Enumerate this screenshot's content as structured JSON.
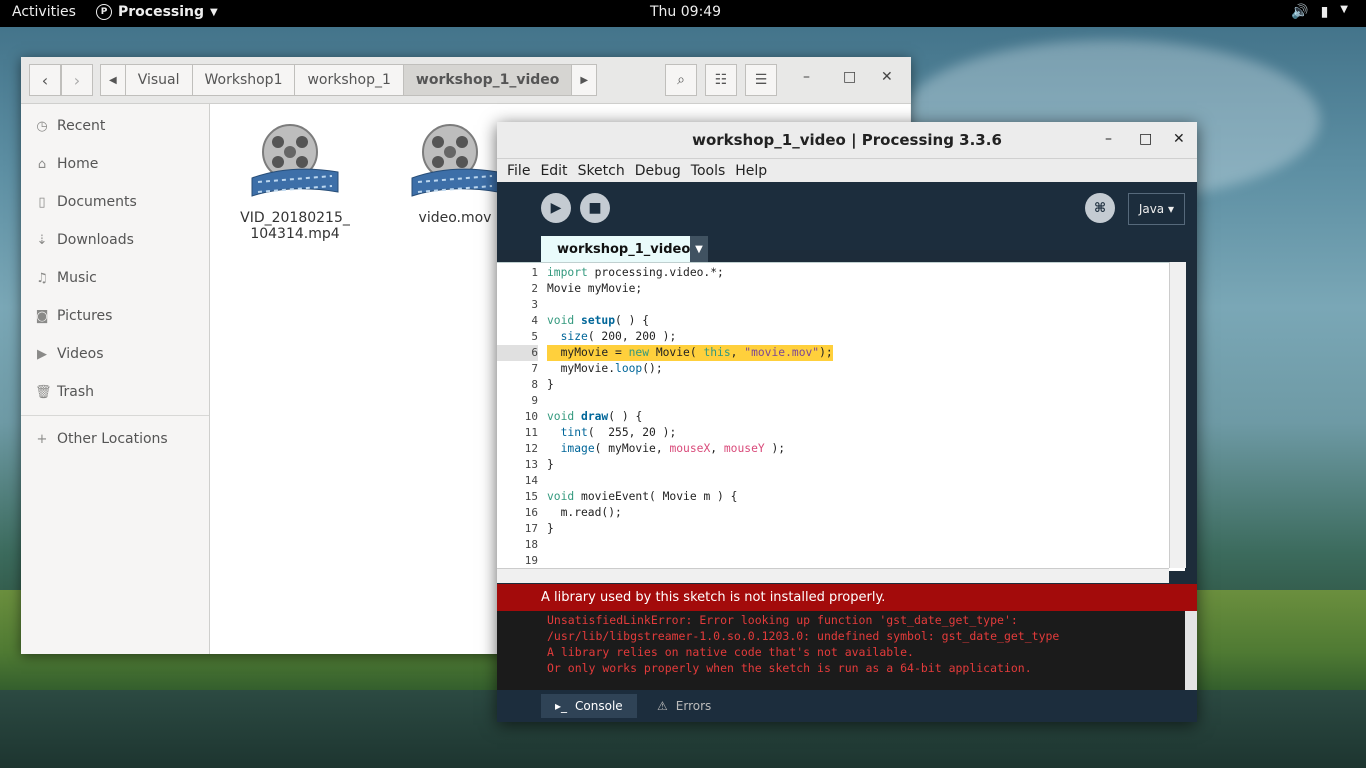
{
  "topbar": {
    "activities": "Activities",
    "app": "Processing",
    "clock": "Thu 09:49"
  },
  "files": {
    "breadcrumbs": [
      "Visual",
      "Workshop1",
      "workshop_1",
      "workshop_1_video"
    ],
    "sidebar": [
      "Recent",
      "Home",
      "Documents",
      "Downloads",
      "Music",
      "Pictures",
      "Videos",
      "Trash",
      "Other Locations"
    ],
    "items": [
      {
        "name_l1": "VID_20180215_",
        "name_l2": "104314.mp4"
      },
      {
        "name_l1": "video.mov",
        "name_l2": ""
      }
    ]
  },
  "processing": {
    "title": "workshop_1_video | Processing 3.3.6",
    "menu": [
      "File",
      "Edit",
      "Sketch",
      "Debug",
      "Tools",
      "Help"
    ],
    "mode": "Java ▾",
    "tab": "workshop_1_video",
    "lines": [
      "import processing.video.*;",
      "Movie myMovie;",
      "",
      "void setup( ) {",
      "  size( 200, 200 );",
      "  myMovie = new Movie( this, \"movie.mov\");",
      "  myMovie.loop();",
      "}",
      "",
      "void draw( ) {",
      "  tint(  255, 20 );",
      "  image( myMovie, mouseX, mouseY );",
      "}",
      "",
      "void movieEvent( Movie m ) {",
      "  m.read();",
      "}",
      "",
      ""
    ],
    "line_numbers": [
      "1",
      "2",
      "3",
      "4",
      "5",
      "6",
      "7",
      "8",
      "9",
      "10",
      "11",
      "12",
      "13",
      "14",
      "15",
      "16",
      "17",
      "18",
      "19"
    ],
    "error_message": "A library used by this sketch is not installed properly.",
    "console": [
      "UnsatisfiedLinkError: Error looking up function 'gst_date_get_type':",
      "/usr/lib/libgstreamer-1.0.so.0.1203.0: undefined symbol: gst_date_get_type",
      "A library relies on native code that's not available.",
      "Or only works properly when the sketch is run as a 64-bit application."
    ],
    "footer_tabs": [
      "Console",
      "Errors"
    ]
  }
}
